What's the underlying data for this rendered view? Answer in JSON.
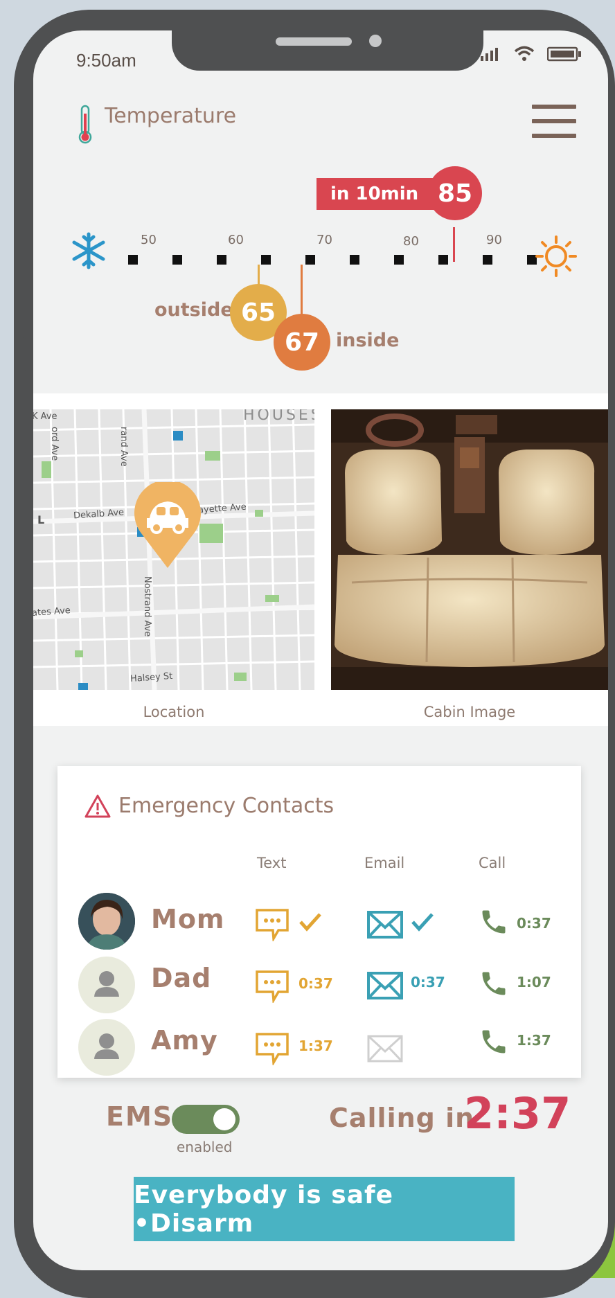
{
  "status_bar": {
    "time": "9:50am"
  },
  "header": {
    "title": "Temperature"
  },
  "temperature": {
    "ticks": [
      "50",
      "60",
      "70",
      "80",
      "90"
    ],
    "forecast": {
      "label": "in 10min",
      "value": "85"
    },
    "outside": {
      "label": "outside",
      "value": "65"
    },
    "inside": {
      "label": "inside",
      "value": "67"
    }
  },
  "tiles": {
    "location_caption": "Location",
    "cabin_caption": "Cabin Image",
    "map_labels": {
      "houses": "HOUSES",
      "k_ave": "K Ave",
      "ford_ave": "ord Ave",
      "grand_ave": "rand Ave",
      "dekalb": "Dekalb Ave",
      "lafayette": "ayette Ave",
      "nostrand": "Nostrand Ave",
      "gates": "ates Ave",
      "halsey": "Halsey St",
      "l_marker": "L"
    }
  },
  "emergency": {
    "title": "Emergency Contacts",
    "columns": {
      "text": "Text",
      "email": "Email",
      "call": "Call"
    },
    "contacts": [
      {
        "name": "Mom",
        "text_status": "",
        "email_status": "",
        "call_time": "0:37"
      },
      {
        "name": "Dad",
        "text_status": "0:37",
        "email_status": "0:37",
        "call_time": "1:07"
      },
      {
        "name": "Amy",
        "text_status": "1:37",
        "email_status": "",
        "call_time": "1:37"
      }
    ]
  },
  "ems": {
    "label": "EMS",
    "toggle_state": "enabled"
  },
  "countdown": {
    "label": "Calling in",
    "value": "2:37"
  },
  "disarm_button": {
    "label": "Everybody is safe •Disarm"
  },
  "colors": {
    "accent_red": "#d2425a",
    "teal": "#49b3c3",
    "green": "#6b8b5b",
    "text_brown": "#a67f6e",
    "outside_badge": "#e3ad4a",
    "inside_badge": "#e07c40"
  }
}
